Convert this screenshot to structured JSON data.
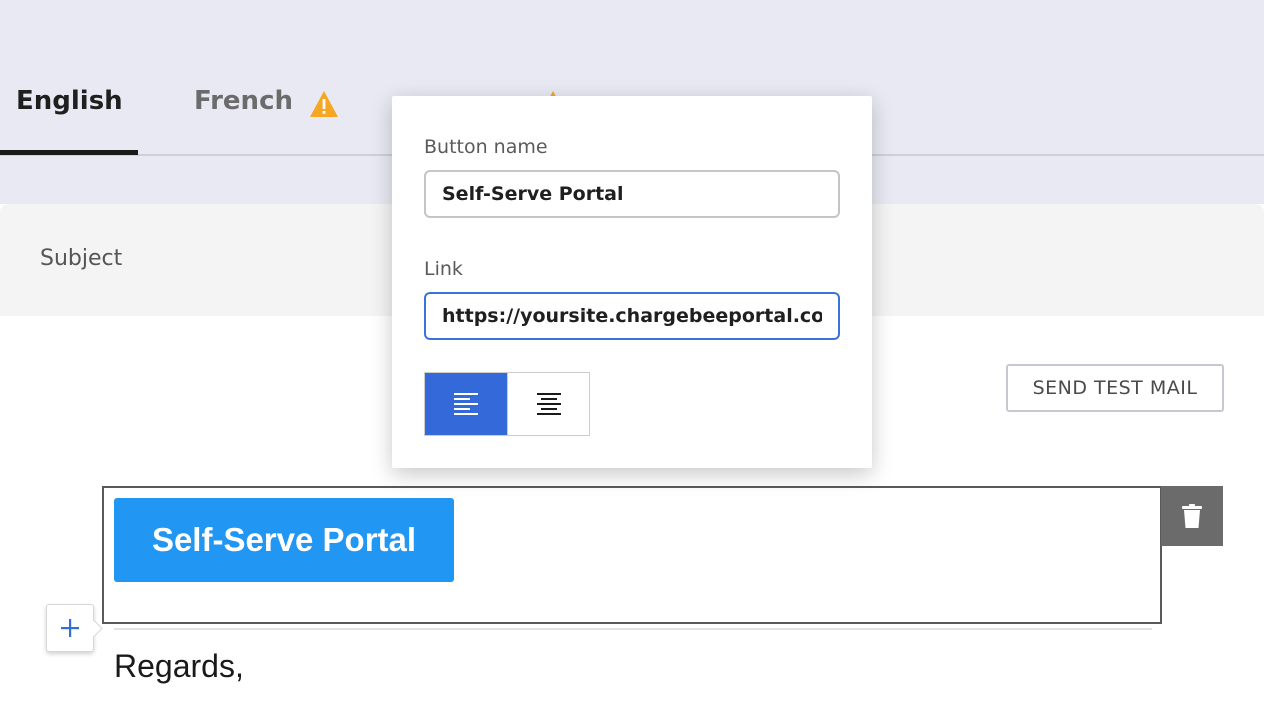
{
  "tabs": [
    {
      "label": "English",
      "active": true,
      "warning": false
    },
    {
      "label": "French",
      "active": false,
      "warning": true
    },
    {
      "label": "",
      "active": false,
      "warning": true
    }
  ],
  "subject": {
    "label": "Subject"
  },
  "toolbar": {
    "send_test_label": "SEND TEST MAIL"
  },
  "email_body": {
    "portal_button_label": "Self-Serve Portal",
    "portal_button_color": "#2196f3",
    "closing_text": "Regards,"
  },
  "popover": {
    "button_name_label": "Button name",
    "button_name_value": "Self-Serve Portal",
    "link_label": "Link",
    "link_value": "https://yoursite.chargebeeportal.com",
    "alignment_options": [
      "align-left",
      "align-center"
    ],
    "selected_alignment": "align-left"
  },
  "colors": {
    "accent": "#3469d9",
    "warning": "#f5a623",
    "delete_bg": "#6b6b6b"
  },
  "icons": {
    "warning": "warning-icon",
    "delete": "trash-icon",
    "add": "plus-icon",
    "align_left": "align-left-icon",
    "align_center": "align-center-icon"
  }
}
